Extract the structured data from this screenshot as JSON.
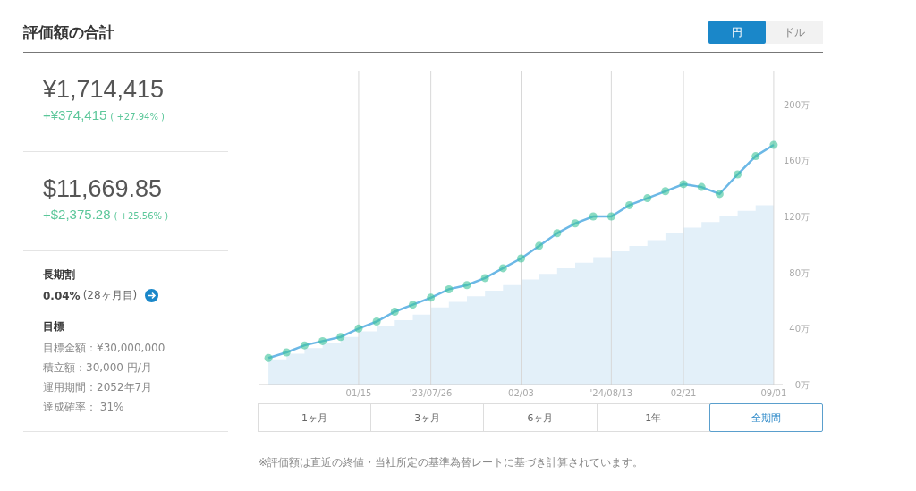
{
  "title": "評価額の合計",
  "currency_toggle": [
    {
      "label": "円",
      "selected": true
    },
    {
      "label": "ドル",
      "selected": false
    }
  ],
  "totals": [
    {
      "amount": "¥1,714,415",
      "gain": "+¥374,415",
      "gain_pct": "( +27.94% )"
    },
    {
      "amount": "$11,669.85",
      "gain": "+$2,375.28",
      "gain_pct": "( +25.56% )"
    }
  ],
  "long_term": {
    "heading": "長期割",
    "rate": "0.04%",
    "note": "(28ヶ月目)"
  },
  "goal": {
    "heading": "目標",
    "lines": [
      "目標金額：¥30,000,000",
      "積立額：30,000 円/月",
      "運用期間：2052年7月",
      "達成確率： 31%"
    ]
  },
  "chart": {
    "chart_data": {
      "type": "line",
      "categories": [
        null,
        null,
        null,
        null,
        null,
        "01/15",
        null,
        null,
        null,
        "'23/07/26",
        null,
        null,
        null,
        null,
        "02/03",
        null,
        null,
        null,
        null,
        "'24/08/13",
        null,
        null,
        null,
        "02/21",
        null,
        null,
        null,
        null,
        "09/01"
      ],
      "grid": true,
      "series": [
        {
          "type": "line",
          "marker": "circle",
          "color": "#6cb8e6",
          "values": [
            19,
            23,
            28,
            31,
            34,
            40,
            45,
            52,
            57,
            62,
            68,
            71,
            76,
            83,
            90,
            99,
            108,
            115,
            120,
            120,
            128,
            133,
            138,
            143,
            141,
            136,
            150,
            163,
            171
          ]
        },
        {
          "type": "area",
          "color": "#e3f0f9",
          "values": [
            18,
            22,
            26,
            30,
            34,
            38,
            42,
            46,
            50,
            55,
            59,
            63,
            67,
            71,
            75,
            79,
            83,
            87,
            91,
            95,
            99,
            103,
            108,
            112,
            116,
            120,
            124,
            128,
            132
          ]
        }
      ],
      "ylim": [
        0,
        224
      ],
      "yticks": [
        {
          "value": 0,
          "label": "0万"
        },
        {
          "value": 40,
          "label": "40万"
        },
        {
          "value": 80,
          "label": "80万"
        },
        {
          "value": 120,
          "label": "120万"
        },
        {
          "value": 160,
          "label": "160万"
        },
        {
          "value": 200,
          "label": "200万"
        }
      ]
    }
  },
  "periods": [
    {
      "label": "1ヶ月",
      "selected": false
    },
    {
      "label": "3ヶ月",
      "selected": false
    },
    {
      "label": "6ヶ月",
      "selected": false
    },
    {
      "label": "1年",
      "selected": false
    },
    {
      "label": "全期間",
      "selected": true
    }
  ],
  "footnote": "※評価額は直近の終値・当社所定の基準為替レートに基づき計算されています。"
}
